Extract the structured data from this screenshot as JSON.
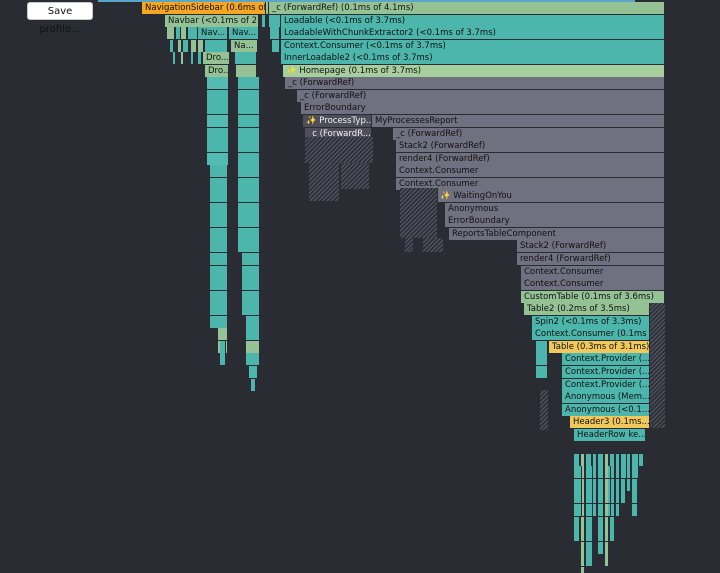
{
  "save_button": "Save profile...",
  "colors": {
    "background": "#2a2c33",
    "teal": "#4db6ac",
    "sage": "#94c295",
    "gold": "#f0c85c",
    "orange": "#f5a623",
    "grey": "#6f7080"
  },
  "labels": {
    "nav_sidebar": "NavigationSidebar (0.6ms of...",
    "forwardref_top": "_c (ForwardRef) (0.1ms of 4.1ms)",
    "navbar": "Navbar (<0.1ms of 2....",
    "nav1": "Nav...",
    "nav2": "Nav...",
    "na": "Na...",
    "dro1": "Dro...",
    "dro2": "Dro...",
    "loadable": "Loadable (<0.1ms of 3.7ms)",
    "loadable_chunk": "LoadableWithChunkExtractor2 (<0.1ms of 3.7ms)",
    "context_consumer_1": "Context.Consumer (<0.1ms of 3.7ms)",
    "inner_loadable": "InnerLoadable2 (<0.1ms of 3.7ms)",
    "homepage": "Homepage (0.1ms of 3.7ms)",
    "forwardref_1": "_c (ForwardRef)",
    "forwardref_2": "_c (ForwardRef)",
    "error_boundary_1": "ErrorBoundary",
    "process_typ": "ProcessTyp...",
    "my_processes": "MyProcessesReport",
    "forwardref_3": "_c (ForwardR...",
    "forwardref_4": "_c (ForwardRef)",
    "stack2_1": "Stack2 (ForwardRef)",
    "render4_1": "render4 (ForwardRef)",
    "context_consumer_2": "Context.Consumer",
    "context_consumer_3": "Context.Consumer",
    "waiting_on_you": "WaitingOnYou",
    "anonymous_1": "Anonymous",
    "error_boundary_2": "ErrorBoundary",
    "reports_table": "ReportsTableComponent",
    "stack2_2": "Stack2 (ForwardRef)",
    "render4_2": "render4 (ForwardRef)",
    "context_consumer_4": "Context.Consumer",
    "context_consumer_5": "Context.Consumer",
    "custom_table": "CustomTable (0.1ms of 3.6ms)",
    "table2": "Table2 (0.2ms of 3.5ms)",
    "spin2": "Spin2 (<0.1ms of 3.3ms)",
    "context_consumer_6": "Context.Consumer (0.1ms ...",
    "table": "Table (0.3ms of 3.1ms)",
    "context_provider_1": "Context.Provider (...",
    "context_provider_2": "Context.Provider (...",
    "context_provider_3": "Context.Provider (...",
    "anonymous_mem": "Anonymous (Mem...",
    "anonymous_2": "Anonymous (<0.1...",
    "header3": "Header3 (0.1ms...",
    "header_row": "HeaderRow ke..."
  }
}
